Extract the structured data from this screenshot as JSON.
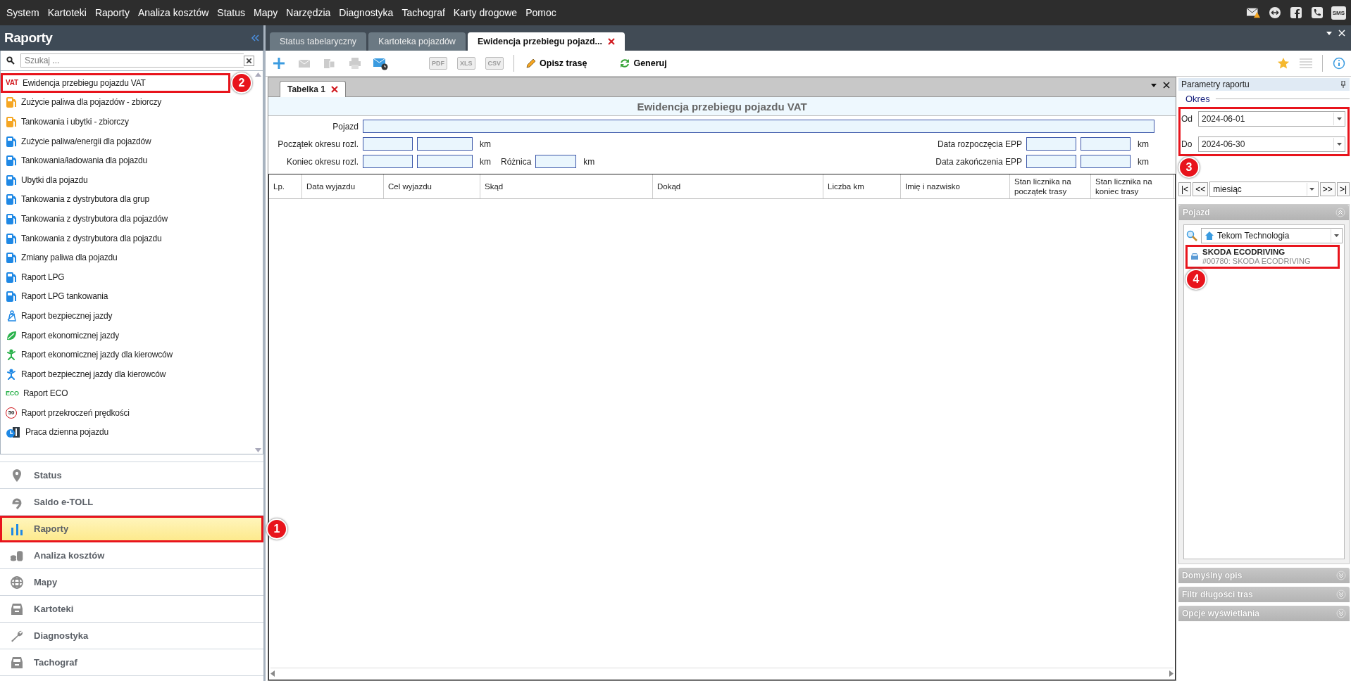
{
  "menu": [
    "System",
    "Kartoteki",
    "Raporty",
    "Analiza kosztów",
    "Status",
    "Mapy",
    "Narzędzia",
    "Diagnostyka",
    "Tachograf",
    "Karty drogowe",
    "Pomoc"
  ],
  "sms_label": "SMS",
  "left": {
    "title": "Raporty",
    "search": {
      "placeholder": "Szukaj ..."
    },
    "reports": [
      {
        "label": "Ewidencja przebiegu pojazdu VAT",
        "kind": "tag",
        "badge": "VAT",
        "callout": "2"
      },
      {
        "label": "Zużycie paliwa dla pojazdów - zbiorczy",
        "kind": "fuel",
        "color": "#f5a623"
      },
      {
        "label": "Tankowania i ubytki - zbiorczy",
        "kind": "fuel",
        "color": "#f5a623"
      },
      {
        "label": "Zużycie paliwa/energii dla pojazdów",
        "kind": "fuel",
        "color": "#1e88e5"
      },
      {
        "label": "Tankowania/ładowania dla pojazdu",
        "kind": "fuel",
        "color": "#1e88e5"
      },
      {
        "label": "Ubytki dla pojazdu",
        "kind": "fuel",
        "color": "#1e88e5"
      },
      {
        "label": "Tankowania z dystrybutora dla grup",
        "kind": "fuel",
        "color": "#1e88e5"
      },
      {
        "label": "Tankowania z dystrybutora dla pojazdów",
        "kind": "fuel",
        "color": "#1e88e5"
      },
      {
        "label": "Tankowania z dystrybutora dla pojazdu",
        "kind": "fuel",
        "color": "#1e88e5"
      },
      {
        "label": "Zmiany paliwa dla pojazdu",
        "kind": "fuel",
        "color": "#1e88e5"
      },
      {
        "label": "Raport LPG",
        "kind": "fuel",
        "color": "#1e88e5"
      },
      {
        "label": "Raport LPG tankowania",
        "kind": "fuel",
        "color": "#1e88e5"
      },
      {
        "label": "Raport bezpiecznej jazdy",
        "kind": "seatbelt"
      },
      {
        "label": "Raport ekonomicznej jazdy",
        "kind": "leaf"
      },
      {
        "label": "Raport ekonomicznej jazdy dla kierowców",
        "kind": "runner",
        "color": "#2bb24c"
      },
      {
        "label": "Raport bezpiecznej jazdy dla kierowców",
        "kind": "runner",
        "color": "#1e88e5"
      },
      {
        "label": "Raport ECO",
        "kind": "eco",
        "badge": "ECO"
      },
      {
        "label": "Raport przekroczeń prędkości",
        "kind": "speed",
        "badge": "50"
      },
      {
        "label": "Praca dzienna pojazdu",
        "kind": "clock"
      }
    ],
    "nav": [
      {
        "label": "Status",
        "kind": "pin",
        "selected": false
      },
      {
        "label": "Saldo e-TOLL",
        "kind": "etoll",
        "selected": false
      },
      {
        "label": "Raporty",
        "kind": "bars",
        "selected": true,
        "callout": "1"
      },
      {
        "label": "Analiza kosztów",
        "kind": "coins",
        "selected": false
      },
      {
        "label": "Mapy",
        "kind": "globe",
        "selected": false
      },
      {
        "label": "Kartoteki",
        "kind": "drawer",
        "selected": false
      },
      {
        "label": "Diagnostyka",
        "kind": "wrench",
        "selected": false
      },
      {
        "label": "Tachograf",
        "kind": "drawer",
        "selected": false
      }
    ]
  },
  "tabs": [
    {
      "label": "Status tabelaryczny",
      "selected": false
    },
    {
      "label": "Kartoteka pojazdów",
      "selected": false
    },
    {
      "label": "Ewidencja przebiegu pojazd...",
      "selected": true
    }
  ],
  "toolbar": {
    "exports": [
      {
        "label": "PDF",
        "disabled": true
      },
      {
        "label": "XLS",
        "disabled": true
      },
      {
        "label": "CSV",
        "disabled": true
      }
    ],
    "describe": "Opisz trasę",
    "generate": "Generuj"
  },
  "panel": {
    "tab": "Tabelka 1",
    "title": "Ewidencja przebiegu pojazdu VAT",
    "vehicle_label": "Pojazd",
    "rows": [
      {
        "label": "Początek okresu rozl.",
        "unit": "km",
        "right_label": "Data rozpoczęcia EPP",
        "right_unit": "km"
      },
      {
        "label": "Koniec okresu rozl.",
        "unit": "km",
        "diff_label": "Różnica",
        "diff_unit": "km",
        "right_label": "Data zakończenia EPP",
        "right_unit": "km"
      }
    ],
    "columns": [
      "Lp.",
      "Data wyjazdu",
      "Cel wyjazdu",
      "Skąd",
      "Dokąd",
      "Liczba km",
      "Imię i nazwisko",
      "Stan licznika na początek trasy",
      "Stan licznika na koniec trasy"
    ]
  },
  "params": {
    "title": "Parametry raportu",
    "period": {
      "legend": "Okres",
      "from_label": "Od",
      "from": "2024-06-01",
      "to_label": "Do",
      "to": "2024-06-30",
      "callout": "3"
    },
    "stepper": {
      "first": "|<",
      "prev": "<<",
      "unit": "miesiąc",
      "next": ">>",
      "last": ">|"
    },
    "vehicle_section": {
      "title": "Pojazd",
      "expanded": true,
      "group": "Tekom Technologia",
      "vehicles": [
        {
          "name": "SKODA ECODRIVING",
          "detail": "#00780: SKODA ECODRIVING",
          "callout": "4"
        }
      ]
    },
    "sections": [
      {
        "title": "Domyślny opis",
        "expanded": false
      },
      {
        "title": "Filtr długości tras",
        "expanded": false
      },
      {
        "title": "Opcje wyświetlania",
        "expanded": false
      }
    ]
  }
}
